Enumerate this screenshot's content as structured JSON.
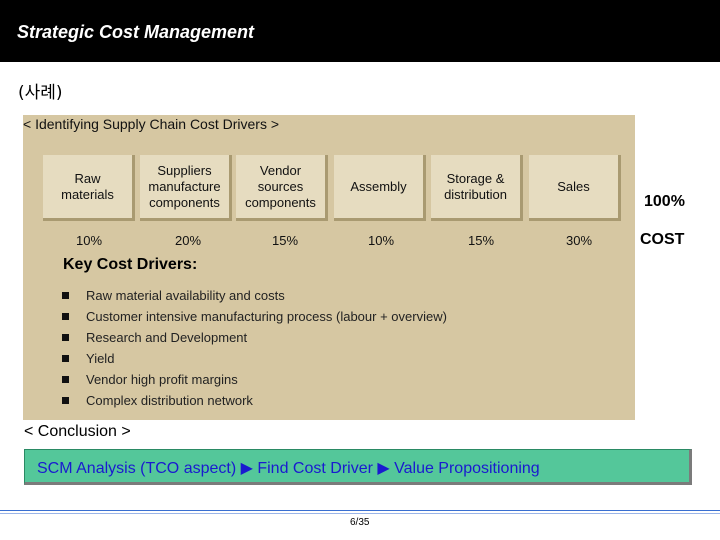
{
  "header": {
    "title": "Strategic Cost Management"
  },
  "example_label": "(사례)",
  "panel": {
    "heading": "< Identifying Supply Chain Cost Drivers >",
    "stages": [
      {
        "label": "Raw\nmaterials",
        "pct": "10%"
      },
      {
        "label": "Suppliers\nmanufacture\ncomponents",
        "pct": "20%"
      },
      {
        "label": "Vendor\nsources\ncomponents",
        "pct": "15%"
      },
      {
        "label": "Assembly",
        "pct": "10%"
      },
      {
        "label": "Storage &\ndistribution",
        "pct": "15%"
      },
      {
        "label": "Sales",
        "pct": "30%"
      }
    ],
    "total_pct": "100%",
    "total_label": "COST",
    "drivers_title": "Key Cost Drivers:",
    "drivers": [
      "Raw material availability and costs",
      "Customer intensive manufacturing process (labour + overview)",
      "Research and Development",
      "Yield",
      "Vendor high profit margins",
      "Complex distribution network"
    ]
  },
  "conclusion": {
    "heading": "< Conclusion >",
    "text": "SCM Analysis (TCO aspect) ▶ Find Cost Driver ▶ Value Propositioning"
  },
  "footer": {
    "page": "6/35"
  }
}
